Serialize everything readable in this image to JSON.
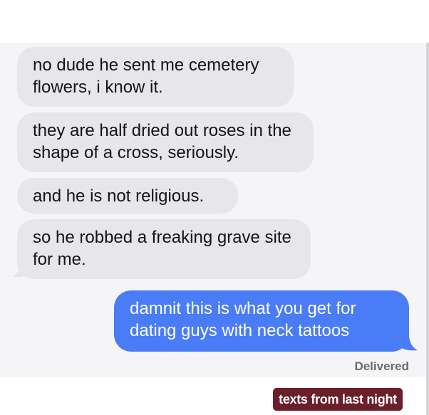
{
  "messages": {
    "received": [
      "no dude he sent me cemetery flowers, i know it.",
      "they are half dried out roses in the shape of a cross, seriously.",
      "and he is not religious.",
      "so he robbed a freaking grave site for me."
    ],
    "sent": [
      "damnit this is what you get for dating guys with neck tattoos"
    ]
  },
  "status": {
    "delivered": "Delivered"
  },
  "watermark": {
    "label": "texts from last night"
  },
  "colors": {
    "received_bubble": "#e6e6eb",
    "sent_bubble": "#4a7cf7",
    "watermark_bg": "#6b1f2a"
  }
}
